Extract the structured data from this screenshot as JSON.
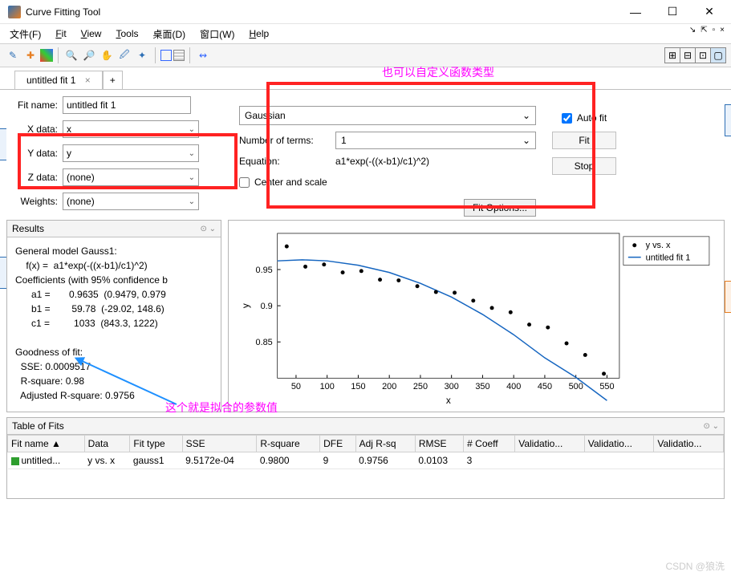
{
  "window": {
    "title": "Curve Fitting Tool"
  },
  "menus": {
    "file": "文件(F)",
    "fit": "Fit",
    "view": "View",
    "tools": "Tools",
    "desktop": "桌面(D)",
    "window": "窗口(W)",
    "help": "Help"
  },
  "tabs": {
    "active": "untitled fit 1",
    "add": "+"
  },
  "left": {
    "fitname_label": "Fit name:",
    "fitname_value": "untitled fit 1",
    "xdata_label": "X data:",
    "xdata_value": "x",
    "ydata_label": "Y data:",
    "ydata_value": "y",
    "zdata_label": "Z data:",
    "zdata_value": "(none)",
    "weights_label": "Weights:",
    "weights_value": "(none)"
  },
  "mid": {
    "model": "Gaussian",
    "nterms_label": "Number of terms:",
    "nterms_value": "1",
    "equation_label": "Equation:",
    "equation_value": "a1*exp(-((x-b1)/c1)^2)",
    "center_label": "Center and scale",
    "fitopts": "Fit Options..."
  },
  "right": {
    "autofit": "Auto fit",
    "fit": "Fit",
    "stop": "Stop"
  },
  "results": {
    "title": "Results",
    "body": "General model Gauss1:\n    f(x) =  a1*exp(-((x-b1)/c1)^2)\nCoefficients (with 95% confidence b\n      a1 =       0.9635  (0.9479, 0.979\n      b1 =        59.78  (-29.02, 148.6)\n      c1 =         1033  (843.3, 1222)\n\nGoodness of fit:\n  SSE: 0.0009517\n  R-square: 0.98\n  Adjusted R-square: 0.9756"
  },
  "annotations": {
    "top": "也可以自定义函数类型",
    "bottom": "这个就是拟合的参数值"
  },
  "chart_data": {
    "type": "line+scatter",
    "xlabel": "x",
    "ylabel": "y",
    "xlim": [
      20,
      570
    ],
    "ylim": [
      0.8,
      1.0
    ],
    "legend": [
      "y vs. x",
      "untitled fit 1"
    ],
    "scatter": {
      "name": "y vs. x",
      "x": [
        35,
        65,
        95,
        125,
        155,
        185,
        215,
        245,
        275,
        305,
        335,
        365,
        395,
        425,
        455,
        485,
        515,
        545
      ],
      "y": [
        0.982,
        0.954,
        0.957,
        0.946,
        0.948,
        0.936,
        0.935,
        0.927,
        0.919,
        0.918,
        0.907,
        0.897,
        0.891,
        0.874,
        0.87,
        0.848,
        0.832,
        0.806
      ]
    },
    "line": {
      "name": "untitled fit 1",
      "x": [
        20,
        60,
        100,
        150,
        200,
        250,
        300,
        350,
        400,
        450,
        500,
        550
      ],
      "y": [
        0.962,
        0.9635,
        0.962,
        0.956,
        0.946,
        0.931,
        0.912,
        0.888,
        0.86,
        0.828,
        0.801,
        0.769
      ]
    }
  },
  "tof": {
    "title": "Table of Fits",
    "cols": [
      "Fit name ▲",
      "Data",
      "Fit type",
      "SSE",
      "R-square",
      "DFE",
      "Adj R-sq",
      "RMSE",
      "# Coeff",
      "Validatio...",
      "Validatio...",
      "Validatio..."
    ],
    "row": [
      "untitled...",
      "y vs. x",
      "gauss1",
      "9.5172e-04",
      "0.9800",
      "9",
      "0.9756",
      "0.0103",
      "3",
      "",
      "",
      ""
    ]
  },
  "watermark": "CSDN @狼洗"
}
